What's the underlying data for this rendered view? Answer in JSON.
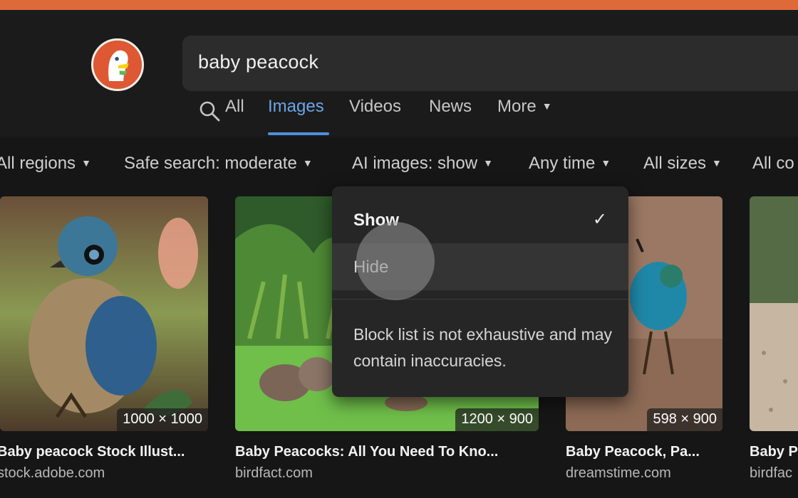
{
  "search": {
    "query": "baby peacock"
  },
  "nav": {
    "items": [
      {
        "label": "All",
        "active": false
      },
      {
        "label": "Images",
        "active": true
      },
      {
        "label": "Videos",
        "active": false
      },
      {
        "label": "News",
        "active": false
      },
      {
        "label": "More",
        "active": false
      }
    ]
  },
  "filters": {
    "items": [
      {
        "label": "All regions"
      },
      {
        "label": "Safe search: moderate"
      },
      {
        "label": "AI images: show"
      },
      {
        "label": "Any time"
      },
      {
        "label": "All sizes"
      },
      {
        "label": "All co"
      }
    ]
  },
  "results": [
    {
      "title": "Baby peacock Stock Illust...",
      "source": "stock.adobe.com",
      "dimensions": "1000 × 1000"
    },
    {
      "title": "Baby Peacocks: All You Need To Kno...",
      "source": "birdfact.com",
      "dimensions": "1200 × 900"
    },
    {
      "title": "Baby Peacock, Pa...",
      "source": "dreamstime.com",
      "dimensions": "598 × 900"
    },
    {
      "title": "Baby P",
      "source": "birdfac",
      "dimensions": ""
    }
  ],
  "dropdown": {
    "options": [
      {
        "label": "Show",
        "selected": true
      },
      {
        "label": "Hide",
        "selected": false
      }
    ],
    "check_glyph": "✓",
    "note": "Block list is not exhaustive and may contain inaccuracies."
  },
  "colors": {
    "accent_bar": "#de6a3a",
    "active_tab": "#6aa5e6",
    "logo": "#de5833"
  },
  "icons": {
    "logo": "duckduckgo-logo",
    "search": "search-icon",
    "caret": "caret-down-icon",
    "check": "checkmark-icon"
  }
}
